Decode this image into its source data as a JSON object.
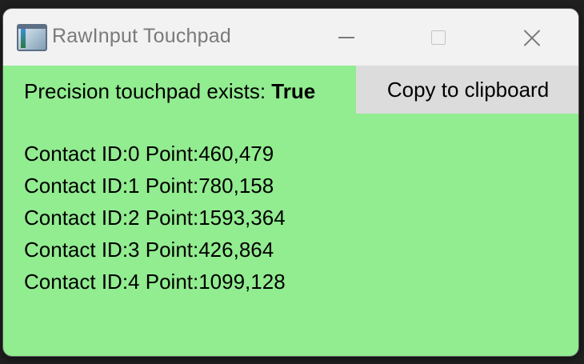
{
  "window": {
    "title": "RawInput Touchpad",
    "background_color": "#92ec90",
    "titlebar_color": "#f2f2f2"
  },
  "icons": {
    "app": "app-window-icon",
    "minimize": "minimize-icon",
    "maximize": "maximize-icon",
    "close": "close-icon"
  },
  "status": {
    "label": "Precision touchpad exists:",
    "value": "True"
  },
  "copy_button": {
    "label": "Copy to clipboard"
  },
  "contacts": [
    {
      "text": "Contact ID:0 Point:460,479"
    },
    {
      "text": "Contact ID:1 Point:780,158"
    },
    {
      "text": "Contact ID:2 Point:1593,364"
    },
    {
      "text": "Contact ID:3 Point:426,864"
    },
    {
      "text": "Contact ID:4 Point:1099,128"
    }
  ]
}
